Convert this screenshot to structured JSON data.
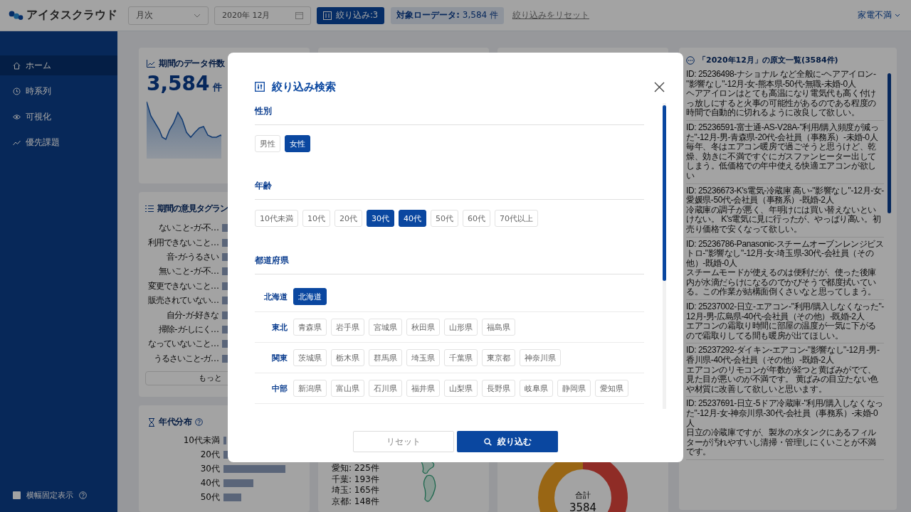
{
  "header": {
    "logo": "アイタスクラウド",
    "period_select": "月次",
    "month_field": "2020年 12月",
    "filter_button": "絞り込み:3",
    "target": {
      "label": "対象ローデータ:",
      "count": "3,584 件"
    },
    "reset_link": "絞り込みをリセット",
    "category_menu": "家電不満"
  },
  "sidebar": {
    "items": [
      {
        "label": "ホーム",
        "selected": true
      },
      {
        "label": "時系列",
        "selected": false
      },
      {
        "label": "可視化",
        "selected": false
      },
      {
        "label": "優先課題",
        "selected": false
      }
    ],
    "fixed_width": {
      "label": "横幅固定表示",
      "checked": false
    }
  },
  "data_count_card": {
    "title": "期間のデータ件数",
    "value": "3,584",
    "unit": "件"
  },
  "tag_ranking_card": {
    "title": "期間の意見タグラン",
    "tags": [
      "ないこと-ガ-不…",
      "利用できないこと…",
      "音-ガ-うるさい",
      "無いこと-ガ-不…",
      "変更できないこと…",
      "販売されていない…",
      "自分-ガ-好きな",
      "掃除-ガ-しにく…",
      "なっていないこと…",
      "うるさいこと-ガ…"
    ],
    "more_button": "もっと"
  },
  "age_card": {
    "title": "年代分布",
    "ages": [
      "10代未満",
      "20代",
      "30代",
      "40代",
      "50代"
    ]
  },
  "prefecture_card": {
    "counts": [
      "愛知: 225件",
      "千葉: 193件",
      "埼玉: 165件",
      "京都: 148件"
    ]
  },
  "total_card": {
    "label": "合計",
    "value": "3584"
  },
  "comments": {
    "title": "「2020年12月」の原文一覧(3584件)",
    "entries": [
      {
        "meta": "ID: 25236498-ナショナル など全般に-ヘアアイロン-\"影響なし\"-12月-女-熊本県-50代-無職-未婚-0人",
        "text": "ヘアアイロンはとても高温になり電気代も高く付けっ放しにすると火事の可能性があるのである程度の時間で自動的に切れるように改良して欲しい。"
      },
      {
        "meta": "ID: 25236591-富士通-AS-V28A-\"利用/購入頻度が減った\"-12月-男-青森県-20代-会社員（事務系）-未婚-0人",
        "text": "毎年、冬はエアコン暖房で過ごそうと思うけど、乾燥、効きに不満ですぐにガスファンヒーター出してしまう。低価格での年中使える快適エアコンが欲しい"
      },
      {
        "meta": "ID: 25236673-K's電気-冷蔵庫 高い-\"影響なし\"-12月-女-愛媛県-50代-会社員（事務系）-既婚-2人",
        "text": "冷蔵庫の調子が悪く、年明けには買い替えないといけない。 K's電気に見に行ったが、やっぱり高い。初売り価格で安くなって欲しい。"
      },
      {
        "meta": "ID: 25236786-Panasonic-スチームオーブンレンジビストロ-\"影響なし\"-12月-女-埼玉県-30代-会社員（その他）-既婚-0人",
        "text": "スチームモードが使えるのは便利だが、使った後庫内が水滴だらけになるのでかびそうで都度拭いている。この作業が結構面倒くさいなと思ってしまう。"
      },
      {
        "meta": "ID: 25237002-日立-エアコン-\"利用/購入しなくなった\"-12月-男-広島県-40代-会社員（その他）-既婚-2人",
        "text": "エアコンの霜取り時間に部屋の温度が一気に下がるので霜取りしてる間も暖房が出てほしい。"
      },
      {
        "meta": "ID: 25237292-ダイキン-エアコン-\"影響なし\"-12月-男-香川県-40代-会社員（その他）-既婚-2人",
        "text": "エアコンのリモコンが年数が経つと黄ばみがでて、見た目が悪いのが不満です。 黄ばみの目立たない色や材質に改善して欲しいと思います。"
      },
      {
        "meta": "ID: 25237691-日立-5ドア冷蔵庫-\"利用/購入しなくなった\"-12月-女-神奈川県-30代-会社員（事務系）-未婚-0人",
        "text": "日立の冷蔵庫ですが、製氷の水タンクにあるフィルターが汚れやすいし清掃・管理しにくいことが不満です。"
      }
    ]
  },
  "filter_dialog": {
    "title": "絞り込み検索",
    "sections": [
      {
        "heading": "性別",
        "kind": "chips",
        "options": [
          {
            "label": "男性",
            "selected": false
          },
          {
            "label": "女性",
            "selected": true
          }
        ]
      },
      {
        "heading": "年齢",
        "kind": "chips",
        "options": [
          {
            "label": "10代未満",
            "selected": false
          },
          {
            "label": "10代",
            "selected": false
          },
          {
            "label": "20代",
            "selected": false
          },
          {
            "label": "30代",
            "selected": true
          },
          {
            "label": "40代",
            "selected": true
          },
          {
            "label": "50代",
            "selected": false
          },
          {
            "label": "60代",
            "selected": false
          },
          {
            "label": "70代以上",
            "selected": false
          }
        ]
      },
      {
        "heading": "都道府県",
        "kind": "regions",
        "regions": [
          {
            "name": "北海道",
            "options": [
              {
                "label": "北海道",
                "selected": true
              }
            ]
          },
          {
            "name": "東北",
            "options": [
              {
                "label": "青森県",
                "selected": false
              },
              {
                "label": "岩手県",
                "selected": false
              },
              {
                "label": "宮城県",
                "selected": false
              },
              {
                "label": "秋田県",
                "selected": false
              },
              {
                "label": "山形県",
                "selected": false
              },
              {
                "label": "福島県",
                "selected": false
              }
            ]
          },
          {
            "name": "関東",
            "options": [
              {
                "label": "茨城県",
                "selected": false
              },
              {
                "label": "栃木県",
                "selected": false
              },
              {
                "label": "群馬県",
                "selected": false
              },
              {
                "label": "埼玉県",
                "selected": false
              },
              {
                "label": "千葉県",
                "selected": false
              },
              {
                "label": "東京都",
                "selected": false
              },
              {
                "label": "神奈川県",
                "selected": false
              }
            ]
          },
          {
            "name": "中部",
            "options": [
              {
                "label": "新潟県",
                "selected": false
              },
              {
                "label": "富山県",
                "selected": false
              },
              {
                "label": "石川県",
                "selected": false
              },
              {
                "label": "福井県",
                "selected": false
              },
              {
                "label": "山梨県",
                "selected": false
              },
              {
                "label": "長野県",
                "selected": false
              },
              {
                "label": "岐阜県",
                "selected": false
              },
              {
                "label": "静岡県",
                "selected": false
              },
              {
                "label": "愛知県",
                "selected": false
              }
            ]
          }
        ]
      }
    ],
    "reset_button": "リセット",
    "apply_button": "絞り込む"
  }
}
